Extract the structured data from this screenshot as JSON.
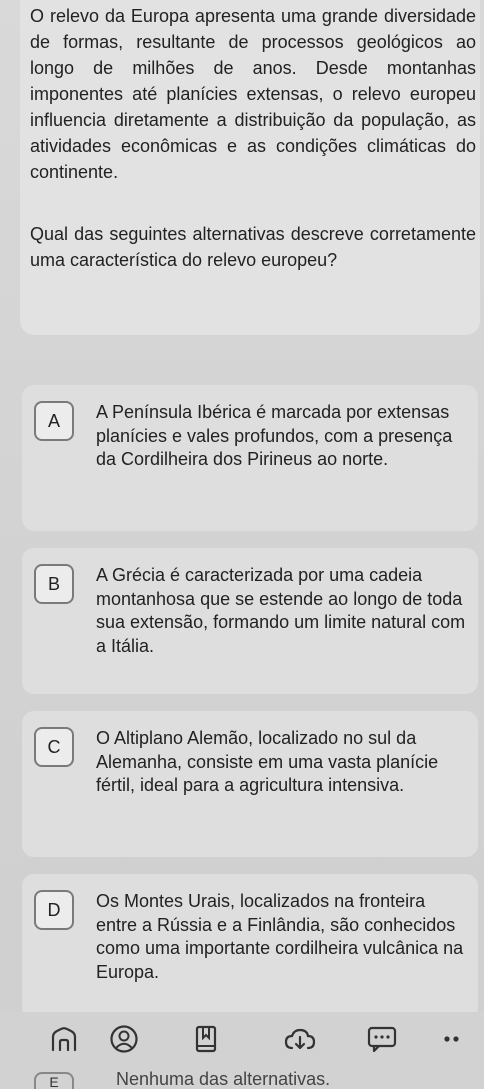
{
  "question": {
    "context": "O relevo da Europa apresenta uma grande diversidade de formas, resultante de processos geológicos ao longo de milhões de anos. Desde montanhas imponentes até planícies extensas, o relevo europeu influencia diretamente a distribuição da população, as atividades econômicas e as condições climáticas do continente.",
    "prompt": "Qual das seguintes alternativas descreve corretamente uma característica do relevo europeu?"
  },
  "options": [
    {
      "letter": "A",
      "text": "A Península Ibérica é marcada por extensas planícies e vales profundos, com a presença da Cordilheira dos Pirineus ao norte."
    },
    {
      "letter": "B",
      "text": "A Grécia é caracterizada por uma cadeia montanhosa que se estende ao longo de toda sua extensão, formando um limite natural com a Itália."
    },
    {
      "letter": "C",
      "text": "O Altiplano Alemão, localizado no sul da Alemanha, consiste em uma vasta planície fértil, ideal para a agricultura intensiva."
    },
    {
      "letter": "D",
      "text": "Os Montes Urais, localizados na fronteira entre a Rússia e a Finlândia, são conhecidos como uma importante cordilheira vulcânica na Europa."
    },
    {
      "letter": "E",
      "text": "Nenhuma das alternativas."
    }
  ],
  "toolbar": {
    "icons": [
      "home-icon",
      "profile-icon",
      "bookmark-icon",
      "cloud-download-icon",
      "comment-icon",
      "more-icon"
    ]
  },
  "colors": {
    "card": "#e2e2e2",
    "background": "#d6d6d6",
    "text": "#222222"
  }
}
